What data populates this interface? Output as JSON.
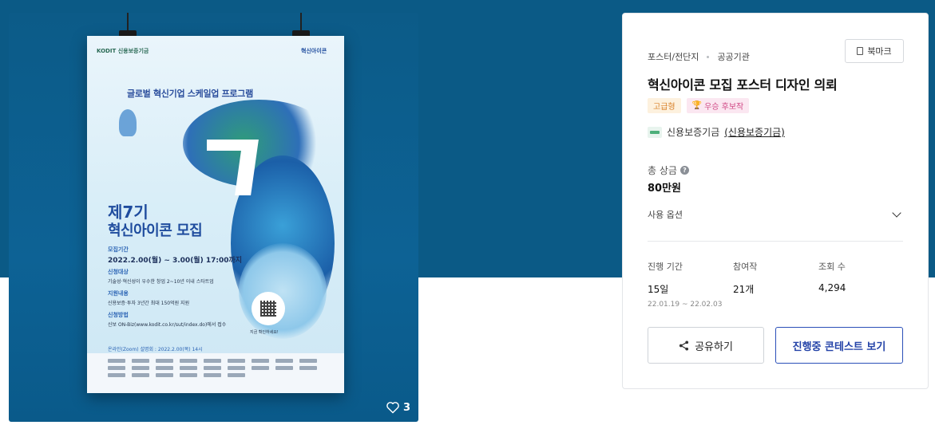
{
  "poster": {
    "banner": "글로벌 혁신기업 스케일업 프로그램",
    "title1": "제7기",
    "title2": "혁신아이콘 모집",
    "logo_left": "KODIT 신용보증기금",
    "logo_right": "혁신아이콘",
    "period_label": "모집기간",
    "period": "2022.2.00(월) ~ 3.00(월) 17:00까지",
    "target_label": "신청대상",
    "target": "기술성·혁신성이 우수한 창업 2~10년 이내 스타트업",
    "support_label": "지원내용",
    "support": "신용보증·투자 3년간 최대 150억원 지원",
    "method_label": "신청방법",
    "method": "신보 ON-Biz(www.kodit.co.kr/sut/index.do)에서 접수",
    "qr_caption": "지금 확인하세요!",
    "briefing": "온라인(Zoom) 설명회 : 2022.2.00(목) 14시"
  },
  "like_count": "3",
  "info": {
    "bookmark_label": "북마크",
    "breadcrumb": [
      "포스터/전단지",
      "공공기관"
    ],
    "title": "혁신아이콘 모집 포스터 디자인 의뢰",
    "badges": {
      "grade": "고급형",
      "pick": "우승 후보작"
    },
    "host_name": "신용보증기금",
    "host_link": "(신용보증기금)",
    "prize_label": "총 상금",
    "prize_value": "80만원",
    "options_label": "사용 옵션",
    "stats": [
      {
        "label": "진행 기간",
        "value": "15일",
        "detail": "22.01.19 ~ 22.02.03"
      },
      {
        "label": "참여작",
        "value": "21개",
        "detail": ""
      },
      {
        "label": "조회 수",
        "value": "4,294",
        "detail": ""
      }
    ],
    "share_label": "공유하기",
    "view_label": "진행중 콘테스트 보기"
  },
  "colors": {
    "hero": "#0b5a86",
    "accent": "#2a4fb8",
    "grade_badge": "#d9822b",
    "pick_badge": "#d04a86"
  }
}
